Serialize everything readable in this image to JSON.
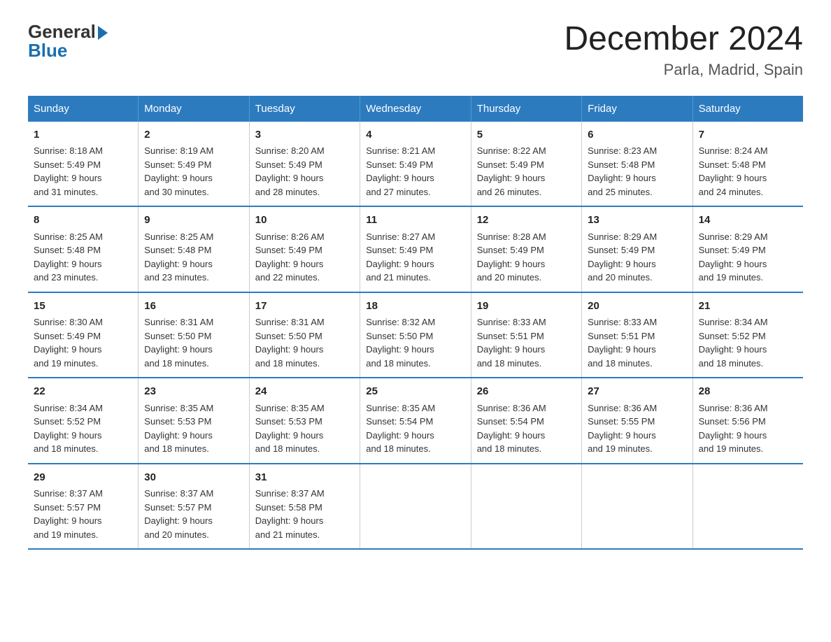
{
  "logo": {
    "line1": "General",
    "arrow": "▶",
    "line2": "Blue"
  },
  "title": "December 2024",
  "subtitle": "Parla, Madrid, Spain",
  "days_header": [
    "Sunday",
    "Monday",
    "Tuesday",
    "Wednesday",
    "Thursday",
    "Friday",
    "Saturday"
  ],
  "weeks": [
    [
      {
        "num": "1",
        "sunrise": "8:18 AM",
        "sunset": "5:49 PM",
        "daylight": "9 hours and 31 minutes."
      },
      {
        "num": "2",
        "sunrise": "8:19 AM",
        "sunset": "5:49 PM",
        "daylight": "9 hours and 30 minutes."
      },
      {
        "num": "3",
        "sunrise": "8:20 AM",
        "sunset": "5:49 PM",
        "daylight": "9 hours and 28 minutes."
      },
      {
        "num": "4",
        "sunrise": "8:21 AM",
        "sunset": "5:49 PM",
        "daylight": "9 hours and 27 minutes."
      },
      {
        "num": "5",
        "sunrise": "8:22 AM",
        "sunset": "5:49 PM",
        "daylight": "9 hours and 26 minutes."
      },
      {
        "num": "6",
        "sunrise": "8:23 AM",
        "sunset": "5:48 PM",
        "daylight": "9 hours and 25 minutes."
      },
      {
        "num": "7",
        "sunrise": "8:24 AM",
        "sunset": "5:48 PM",
        "daylight": "9 hours and 24 minutes."
      }
    ],
    [
      {
        "num": "8",
        "sunrise": "8:25 AM",
        "sunset": "5:48 PM",
        "daylight": "9 hours and 23 minutes."
      },
      {
        "num": "9",
        "sunrise": "8:25 AM",
        "sunset": "5:48 PM",
        "daylight": "9 hours and 23 minutes."
      },
      {
        "num": "10",
        "sunrise": "8:26 AM",
        "sunset": "5:49 PM",
        "daylight": "9 hours and 22 minutes."
      },
      {
        "num": "11",
        "sunrise": "8:27 AM",
        "sunset": "5:49 PM",
        "daylight": "9 hours and 21 minutes."
      },
      {
        "num": "12",
        "sunrise": "8:28 AM",
        "sunset": "5:49 PM",
        "daylight": "9 hours and 20 minutes."
      },
      {
        "num": "13",
        "sunrise": "8:29 AM",
        "sunset": "5:49 PM",
        "daylight": "9 hours and 20 minutes."
      },
      {
        "num": "14",
        "sunrise": "8:29 AM",
        "sunset": "5:49 PM",
        "daylight": "9 hours and 19 minutes."
      }
    ],
    [
      {
        "num": "15",
        "sunrise": "8:30 AM",
        "sunset": "5:49 PM",
        "daylight": "9 hours and 19 minutes."
      },
      {
        "num": "16",
        "sunrise": "8:31 AM",
        "sunset": "5:50 PM",
        "daylight": "9 hours and 18 minutes."
      },
      {
        "num": "17",
        "sunrise": "8:31 AM",
        "sunset": "5:50 PM",
        "daylight": "9 hours and 18 minutes."
      },
      {
        "num": "18",
        "sunrise": "8:32 AM",
        "sunset": "5:50 PM",
        "daylight": "9 hours and 18 minutes."
      },
      {
        "num": "19",
        "sunrise": "8:33 AM",
        "sunset": "5:51 PM",
        "daylight": "9 hours and 18 minutes."
      },
      {
        "num": "20",
        "sunrise": "8:33 AM",
        "sunset": "5:51 PM",
        "daylight": "9 hours and 18 minutes."
      },
      {
        "num": "21",
        "sunrise": "8:34 AM",
        "sunset": "5:52 PM",
        "daylight": "9 hours and 18 minutes."
      }
    ],
    [
      {
        "num": "22",
        "sunrise": "8:34 AM",
        "sunset": "5:52 PM",
        "daylight": "9 hours and 18 minutes."
      },
      {
        "num": "23",
        "sunrise": "8:35 AM",
        "sunset": "5:53 PM",
        "daylight": "9 hours and 18 minutes."
      },
      {
        "num": "24",
        "sunrise": "8:35 AM",
        "sunset": "5:53 PM",
        "daylight": "9 hours and 18 minutes."
      },
      {
        "num": "25",
        "sunrise": "8:35 AM",
        "sunset": "5:54 PM",
        "daylight": "9 hours and 18 minutes."
      },
      {
        "num": "26",
        "sunrise": "8:36 AM",
        "sunset": "5:54 PM",
        "daylight": "9 hours and 18 minutes."
      },
      {
        "num": "27",
        "sunrise": "8:36 AM",
        "sunset": "5:55 PM",
        "daylight": "9 hours and 19 minutes."
      },
      {
        "num": "28",
        "sunrise": "8:36 AM",
        "sunset": "5:56 PM",
        "daylight": "9 hours and 19 minutes."
      }
    ],
    [
      {
        "num": "29",
        "sunrise": "8:37 AM",
        "sunset": "5:57 PM",
        "daylight": "9 hours and 19 minutes."
      },
      {
        "num": "30",
        "sunrise": "8:37 AM",
        "sunset": "5:57 PM",
        "daylight": "9 hours and 20 minutes."
      },
      {
        "num": "31",
        "sunrise": "8:37 AM",
        "sunset": "5:58 PM",
        "daylight": "9 hours and 21 minutes."
      },
      null,
      null,
      null,
      null
    ]
  ],
  "labels": {
    "sunrise": "Sunrise:",
    "sunset": "Sunset:",
    "daylight": "Daylight:"
  }
}
